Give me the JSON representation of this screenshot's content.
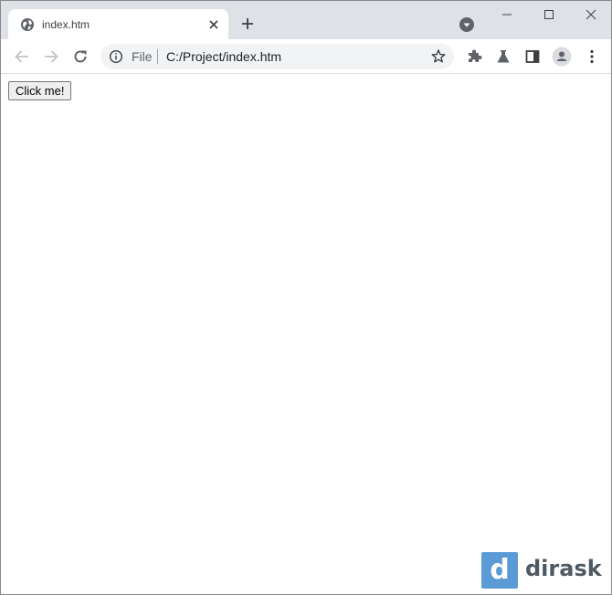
{
  "browser": {
    "tab": {
      "title": "index.htm",
      "favicon": "globe-icon"
    },
    "omnibox": {
      "scheme_label": "File",
      "url": "C:/Project/index.htm"
    },
    "icons": {
      "back": "back-arrow-icon",
      "forward": "forward-arrow-icon",
      "reload": "reload-icon",
      "info": "info-icon",
      "bookmark": "star-icon",
      "extensions": "puzzle-icon",
      "labs": "flask-icon",
      "side_panel": "side-panel-icon",
      "profile": "avatar-icon",
      "menu": "kebab-menu-icon"
    }
  },
  "page": {
    "button_label": "Click me!"
  },
  "watermark": {
    "logo_letter": "d",
    "brand": "dirask",
    "color": "#5b9bd5"
  }
}
